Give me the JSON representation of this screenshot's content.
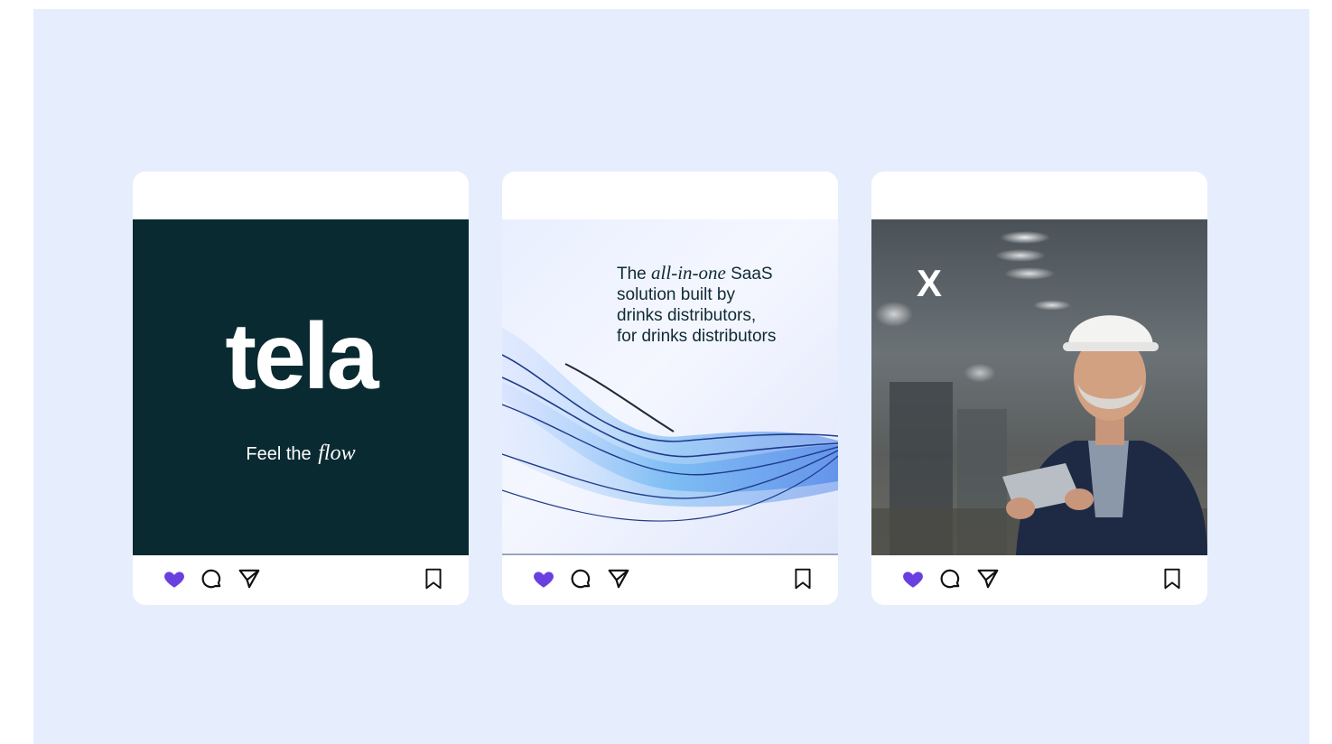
{
  "colors": {
    "background": "#e6edfd",
    "card": "#ffffff",
    "like_active": "#6a3fe0",
    "icon": "#111111",
    "tela_bg": "#0a2a31"
  },
  "posts": [
    {
      "brand": "tela",
      "tagline_start": "Feel the",
      "tagline_italic": "flow",
      "actions": {
        "like_icon": "heart-filled-icon",
        "comment_icon": "comment-icon",
        "share_icon": "send-icon",
        "save_icon": "bookmark-icon",
        "liked": true
      }
    },
    {
      "headline_start": "The",
      "headline_italic": "all-in-one",
      "headline_after": "SaaS",
      "headline_line2": "solution built by",
      "headline_line3": "drinks distributors,",
      "headline_line4": "for drinks distributors",
      "actions": {
        "like_icon": "heart-filled-icon",
        "comment_icon": "comment-icon",
        "share_icon": "send-icon",
        "save_icon": "bookmark-icon",
        "liked": true
      }
    },
    {
      "logo_glyph": "X",
      "image_subject": "smiling worker in hard hat holding tablet in factory",
      "actions": {
        "like_icon": "heart-filled-icon",
        "comment_icon": "comment-icon",
        "share_icon": "send-icon",
        "save_icon": "bookmark-icon",
        "liked": true
      }
    }
  ]
}
